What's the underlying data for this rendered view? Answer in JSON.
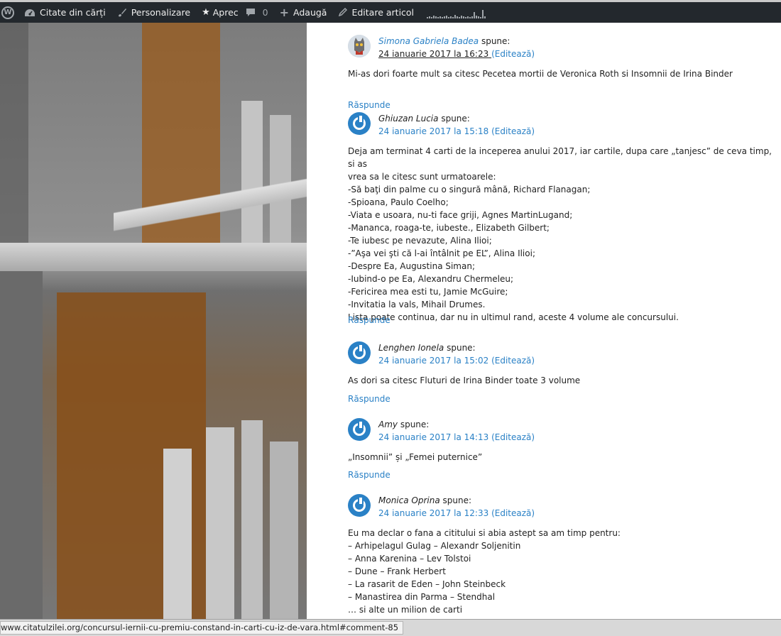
{
  "adminbar": {
    "site_title": "Citate din cărți",
    "customize": "Personalizare",
    "rate": "Aprec",
    "comments_count": "0",
    "add_new": "Adaugă",
    "edit_post": "Editare articol"
  },
  "comments": [
    {
      "author": "Simona Gabriela Badea",
      "says": "spune:",
      "date": "24 ianuarie 2017 la 16:23",
      "edit": "(Editează)",
      "text": [
        "Mi-as dori foarte mult sa citesc Pecetea mortii de Veronica Roth si Insomnii de Irina Binder"
      ],
      "reply": "Răspunde"
    },
    {
      "author": "Ghiuzan Lucia",
      "says": "spune:",
      "date": "24 ianuarie 2017 la 15:18",
      "edit": "(Editează)",
      "text": [
        "Deja am terminat 4 carti de la inceperea anului 2017, iar cartile, dupa care „tanjesc” de ceva timp, si as",
        "vrea sa le citesc sunt urmatoarele:",
        "-Să baţi din palme cu o singură mână, Richard Flanagan;",
        "-Spioana, Paulo Coelho;",
        "-Viata e usoara, nu-ti face griji, Agnes MartinLugand;",
        "-Mananca, roaga-te, iubeste., Elizabeth Gilbert;",
        "-Te iubesc pe nevazute, Alina Ilioi;",
        "-”Aşa vei şti că l-ai întâlnit pe EL”, Alina Ilioi;",
        "-Despre Ea, Augustina Siman;",
        "-Iubind-o pe Ea, Alexandru Chermeleu;",
        "-Fericirea mea esti tu, Jamie McGuire;",
        "-Invitatia la vals, Mihail Drumes.",
        "Lista poate continua, dar nu in ultimul rand, aceste 4 volume ale concursului."
      ],
      "reply": "Răspunde"
    },
    {
      "author": "Lenghen Ionela",
      "says": "spune:",
      "date": "24 ianuarie 2017 la 15:02",
      "edit": "(Editează)",
      "text": [
        "As dori sa citesc Fluturi de Irina Binder toate 3 volume"
      ],
      "reply": "Răspunde"
    },
    {
      "author": "Amy",
      "says": "spune:",
      "date": "24 ianuarie 2017 la 14:13",
      "edit": "(Editează)",
      "text": [
        "„Insomnii” și „Femei puternice”"
      ],
      "reply": "Răspunde"
    },
    {
      "author": "Monica Oprina",
      "says": "spune:",
      "date": "24 ianuarie 2017 la 12:33",
      "edit": "(Editează)",
      "text": [
        "Eu ma declar o fana a cititului si abia astept sa am timp pentru:",
        "– Arhipelagul Gulag – Alexandr Soljenitin",
        "– Anna Karenina – Lev Tolstoi",
        "– Dune – Frank Herbert",
        "– La rasarit de Eden – John Steinbeck",
        "– Manastirea din Parma – Stendhal",
        "… si alte un milion de carti"
      ]
    }
  ],
  "statusbar": {
    "url": "www.citatulzilei.org/concursul-iernii-cu-premiu-constand-in-carti-cu-iz-de-vara.html#comment-85"
  }
}
